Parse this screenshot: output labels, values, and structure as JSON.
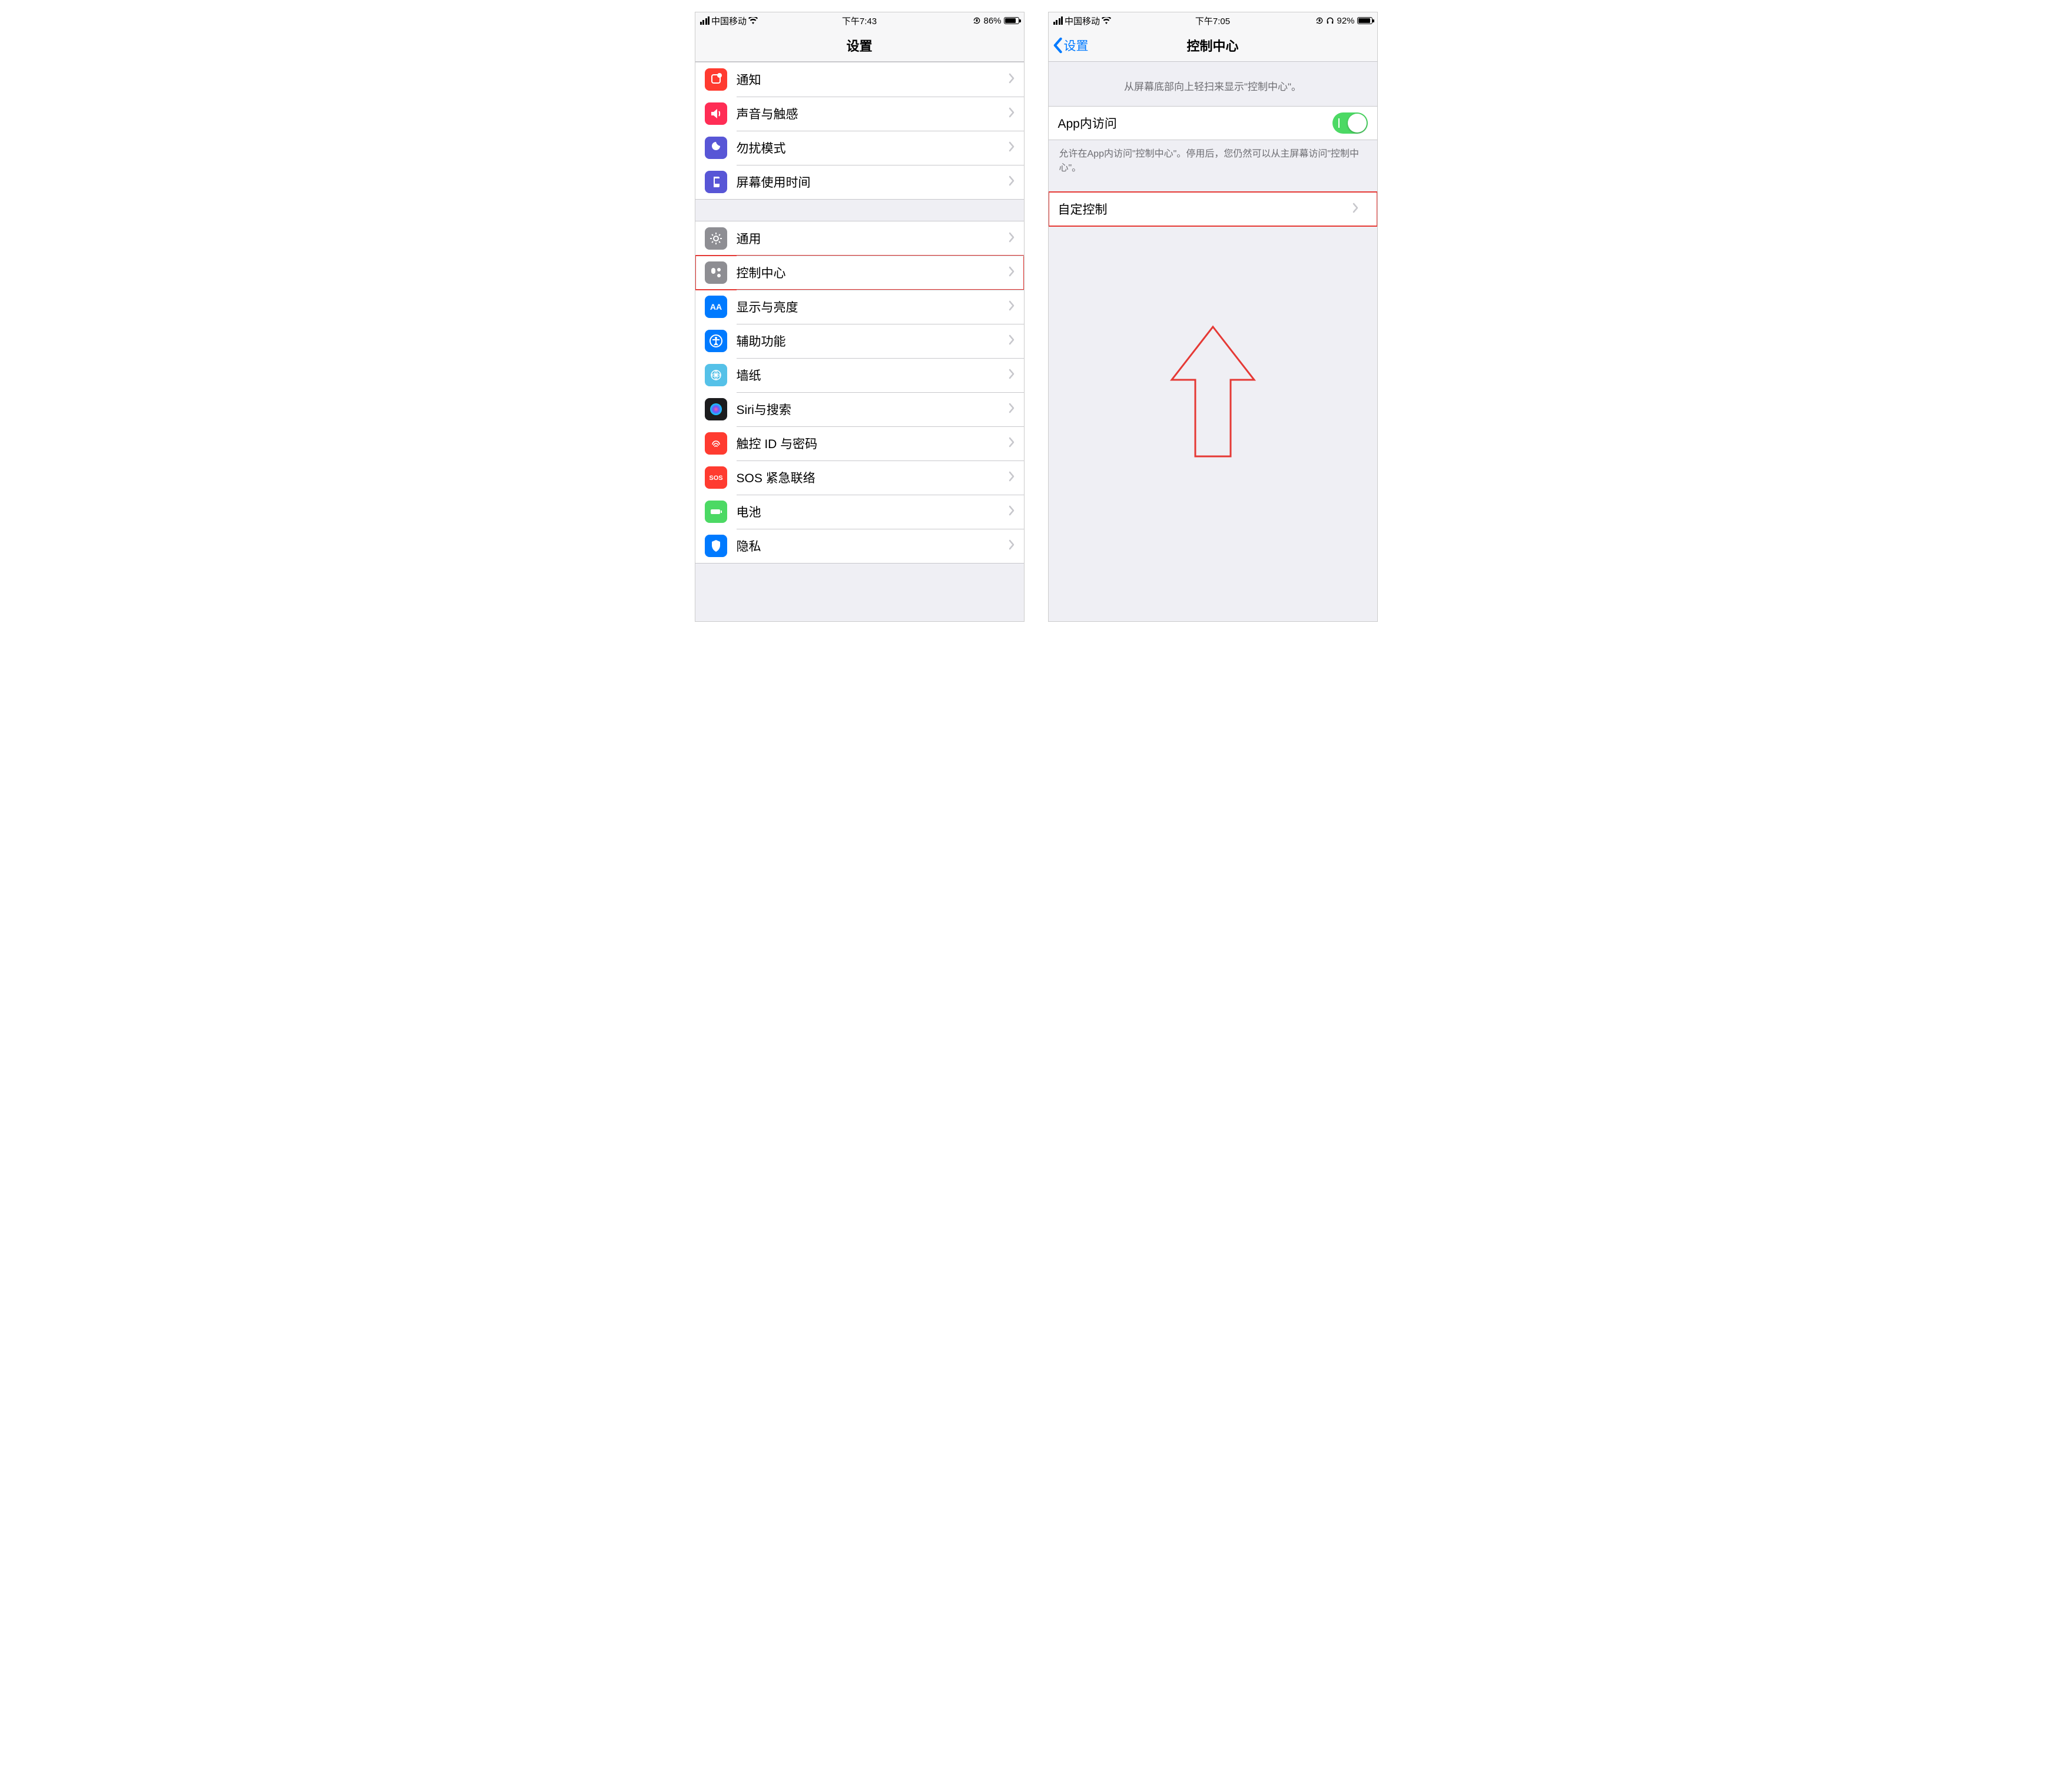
{
  "left": {
    "status": {
      "carrier": "中国移动",
      "time": "下午7:43",
      "battery_pct": "86%",
      "battery_fill_pct": 86
    },
    "nav": {
      "title": "设置"
    },
    "groups": [
      {
        "rows": [
          {
            "key": "notifications",
            "label": "通知",
            "icon_bg": "#ff3b30",
            "highlight": false
          },
          {
            "key": "sounds",
            "label": "声音与触感",
            "icon_bg": "#ff2d55",
            "highlight": false
          },
          {
            "key": "dnd",
            "label": "勿扰模式",
            "icon_bg": "#5856d6",
            "highlight": false
          },
          {
            "key": "screentime",
            "label": "屏幕使用时间",
            "icon_bg": "#5856d6",
            "highlight": false
          }
        ]
      },
      {
        "rows": [
          {
            "key": "general",
            "label": "通用",
            "icon_bg": "#8e8e93",
            "highlight": false
          },
          {
            "key": "controlcenter",
            "label": "控制中心",
            "icon_bg": "#8e8e93",
            "highlight": true
          },
          {
            "key": "display",
            "label": "显示与亮度",
            "icon_bg": "#007aff",
            "highlight": false
          },
          {
            "key": "accessibility",
            "label": "辅助功能",
            "icon_bg": "#007aff",
            "highlight": false
          },
          {
            "key": "wallpaper",
            "label": "墙纸",
            "icon_bg": "#55c1e8",
            "highlight": false
          },
          {
            "key": "siri",
            "label": "Siri与搜索",
            "icon_bg": "#1c1c1e",
            "highlight": false
          },
          {
            "key": "touchid",
            "label": "触控 ID 与密码",
            "icon_bg": "#ff3b30",
            "highlight": false
          },
          {
            "key": "sos",
            "label": "SOS 紧急联络",
            "icon_bg": "#ff3b30",
            "highlight": false
          },
          {
            "key": "battery",
            "label": "电池",
            "icon_bg": "#4cd964",
            "highlight": false
          },
          {
            "key": "privacy",
            "label": "隐私",
            "icon_bg": "#007aff",
            "highlight": false
          }
        ]
      }
    ]
  },
  "right": {
    "status": {
      "carrier": "中国移动",
      "time": "下午7:05",
      "battery_pct": "92%",
      "battery_fill_pct": 92,
      "headphones": true
    },
    "nav": {
      "back": "设置",
      "title": "控制中心"
    },
    "intro": "从屏幕底部向上轻扫来显示\"控制中心\"。",
    "toggle_row": {
      "label": "App内访问",
      "on": true
    },
    "toggle_footer": "允许在App内访问\"控制中心\"。停用后，您仍然可以从主屏幕访问\"控制中心\"。",
    "customize_row": {
      "label": "自定控制",
      "highlight": true
    }
  }
}
